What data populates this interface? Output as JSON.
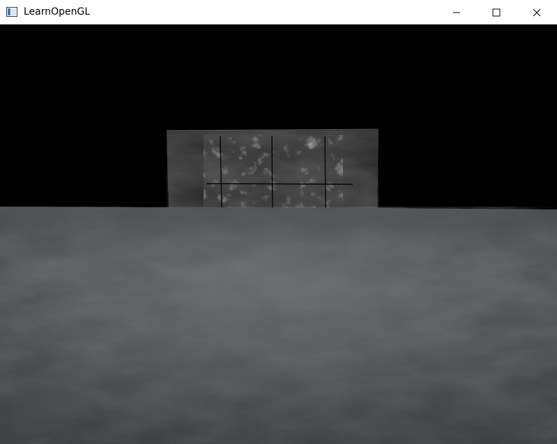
{
  "window": {
    "title": "LearnOpenGL",
    "app_icon": "window-app-icon",
    "controls": {
      "minimize_icon": "minimize-icon",
      "maximize_icon": "maximize-icon",
      "close_icon": "close-icon"
    }
  },
  "scene": {
    "background_color": "#000000",
    "floor_colors": [
      "#3f3f3f",
      "#4b4d4e",
      "#6a6d6f",
      "#585b5c"
    ],
    "wall_colors": [
      "#2e2e2e",
      "#555555",
      "#8a8a8a"
    ]
  }
}
